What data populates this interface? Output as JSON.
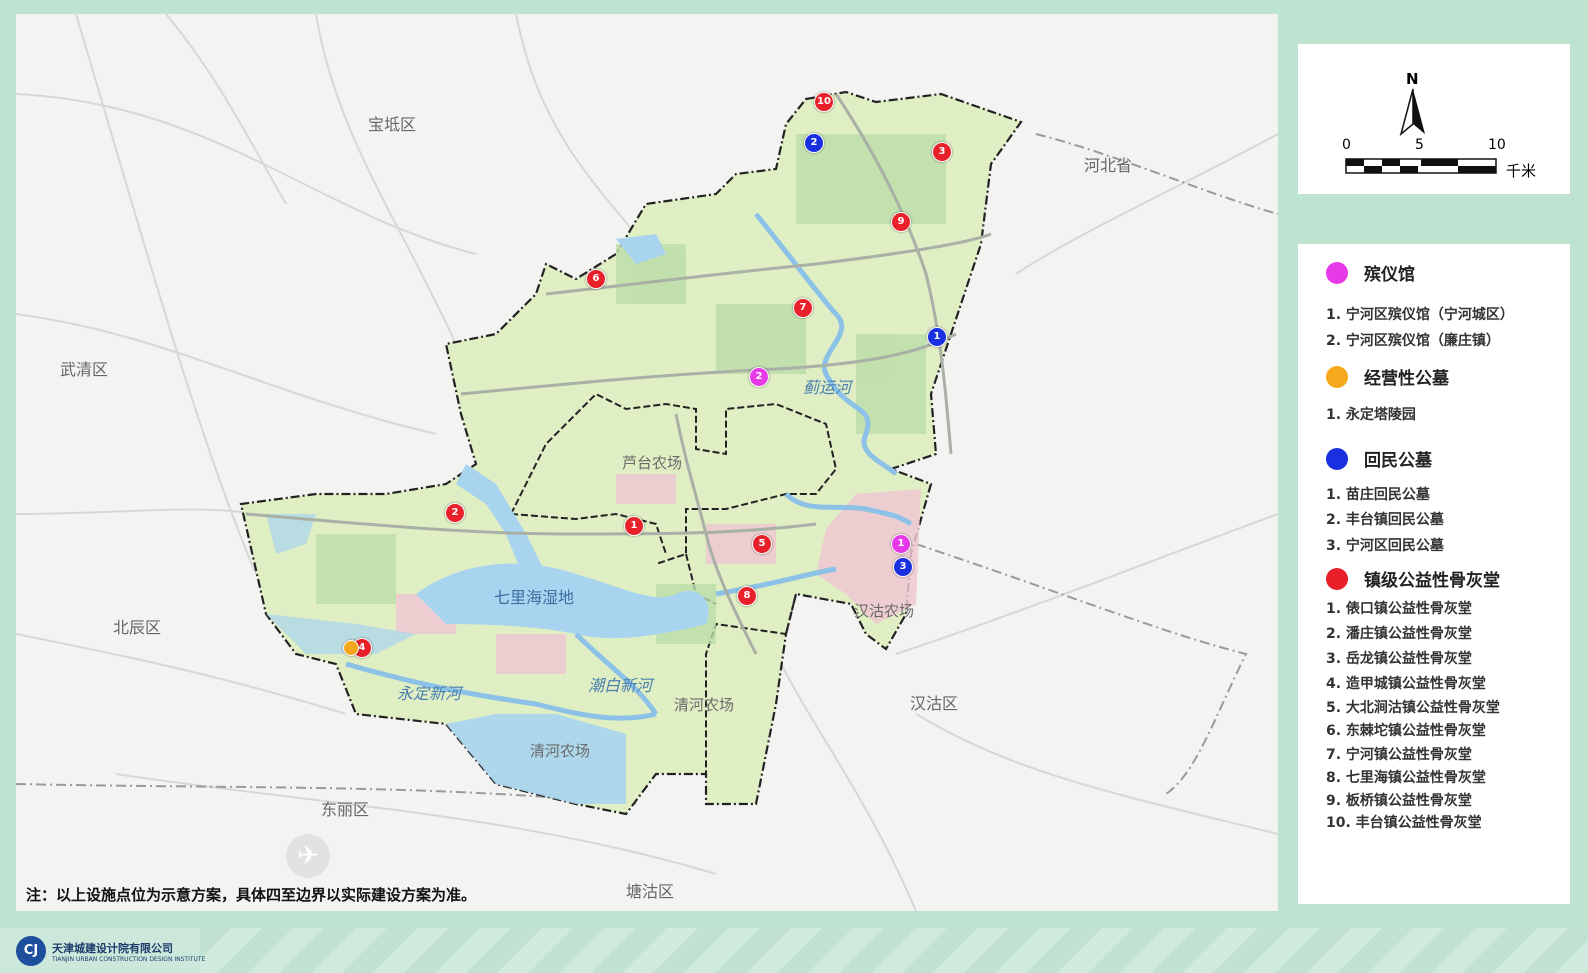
{
  "map": {
    "districts": [
      "宝坻区",
      "河北省",
      "武清区",
      "北辰区",
      "东丽区",
      "汉沽区",
      "塘沽区"
    ],
    "farms": [
      "芦台农场",
      "汉沽农场",
      "清河农场",
      "清河农场"
    ],
    "water": [
      "七里海湿地",
      "蓟运河",
      "永定新河",
      "潮白新河"
    ],
    "note": "注：以上设施点位为示意方案，具体四至边界以实际建设方案为准。"
  },
  "markers": [
    {
      "num": "10",
      "type": "red"
    },
    {
      "num": "3",
      "type": "red"
    },
    {
      "num": "9",
      "type": "red"
    },
    {
      "num": "6",
      "type": "red"
    },
    {
      "num": "7",
      "type": "red"
    },
    {
      "num": "2",
      "type": "red"
    },
    {
      "num": "1",
      "type": "red"
    },
    {
      "num": "5",
      "type": "red"
    },
    {
      "num": "8",
      "type": "red"
    },
    {
      "num": "4",
      "type": "red"
    },
    {
      "num": "2",
      "type": "blue"
    },
    {
      "num": "1",
      "type": "blue"
    },
    {
      "num": "3",
      "type": "blue"
    },
    {
      "num": "2",
      "type": "magenta"
    },
    {
      "num": "1",
      "type": "magenta"
    },
    {
      "num": "",
      "type": "orange"
    }
  ],
  "scale": {
    "north": "N",
    "ticks": [
      "0",
      "5",
      "10"
    ],
    "unit": "千米"
  },
  "legend": {
    "cats": [
      {
        "title": "殡仪馆",
        "color": "#e63ae6",
        "items": [
          "1. 宁河区殡仪馆（宁河城区）",
          "2. 宁河区殡仪馆（廉庄镇）"
        ]
      },
      {
        "title": "经营性公墓",
        "color": "#f5a81c",
        "items": [
          "1. 永定塔陵园"
        ]
      },
      {
        "title": "回民公墓",
        "color": "#1a2fe0",
        "items": [
          "1. 苗庄回民公墓",
          "2. 丰台镇回民公墓",
          "3. 宁河区回民公墓"
        ]
      },
      {
        "title": "镇级公益性骨灰堂",
        "color": "#e8202a",
        "items": [
          "1. 俵口镇公益性骨灰堂",
          "2. 潘庄镇公益性骨灰堂",
          "3. 岳龙镇公益性骨灰堂",
          "4. 造甲城镇公益性骨灰堂",
          "5. 大北涧沽镇公益性骨灰堂",
          "6. 东棘坨镇公益性骨灰堂",
          "7. 宁河镇公益性骨灰堂",
          "8. 七里海镇公益性骨灰堂",
          "9. 板桥镇公益性骨灰堂",
          "10. 丰台镇公益性骨灰堂"
        ]
      }
    ]
  },
  "footer": {
    "company_cn": "天津城建设计院有限公司",
    "company_en": "TIANJIN URBAN CONSTRUCTION DESIGN INSTITUTE",
    "logo_text": "CJ"
  }
}
